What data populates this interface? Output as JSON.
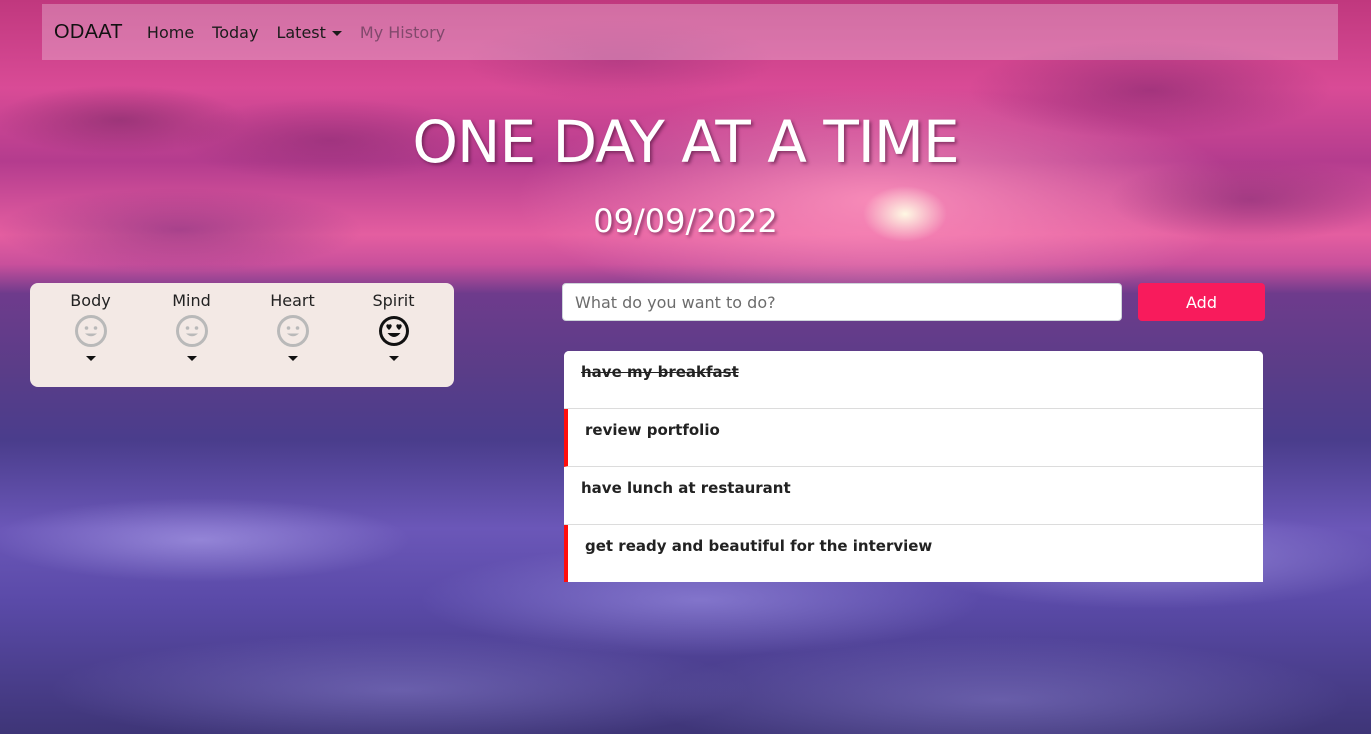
{
  "nav": {
    "brand": "ODAAT",
    "items": [
      {
        "label": "Home"
      },
      {
        "label": "Today"
      },
      {
        "label": "Latest"
      },
      {
        "label": "My History"
      }
    ]
  },
  "hero": {
    "title": "ONE DAY AT A TIME",
    "date": "09/09/2022"
  },
  "moods": [
    {
      "label": "Body",
      "icon": "smile-icon",
      "active": false
    },
    {
      "label": "Mind",
      "icon": "smile-icon",
      "active": false
    },
    {
      "label": "Heart",
      "icon": "smile-icon",
      "active": false
    },
    {
      "label": "Spirit",
      "icon": "heart-eyes-icon",
      "active": true
    }
  ],
  "task_form": {
    "placeholder": "What do you want to do?",
    "add_label": "Add"
  },
  "tasks": [
    {
      "text": "have my breakfast",
      "done": true,
      "flagged": false
    },
    {
      "text": "review portfolio",
      "done": false,
      "flagged": true
    },
    {
      "text": "have lunch at restaurant",
      "done": false,
      "flagged": false
    },
    {
      "text": "get ready and beautiful for the interview",
      "done": false,
      "flagged": true
    }
  ],
  "colors": {
    "accent": "#f81b5c",
    "flag": "#ff0d0d",
    "panel": "#f3e9e5"
  }
}
